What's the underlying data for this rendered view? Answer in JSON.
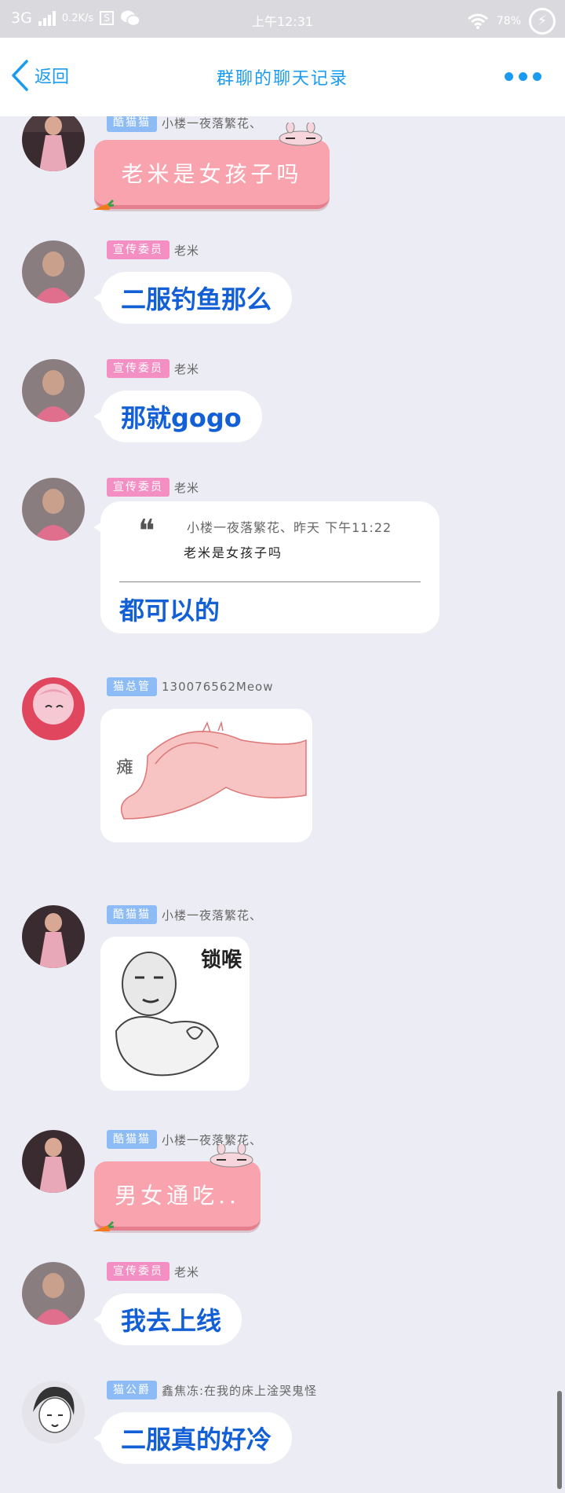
{
  "status_bar": {
    "network": "3G",
    "speed": "0.2K/s",
    "time": "上午12:31",
    "battery": "78%"
  },
  "nav": {
    "back_label": "返回",
    "title": "群聊的聊天记录"
  },
  "messages": [
    {
      "role_badge": "酷猫猫",
      "nickname": "小楼一夜落繁花、",
      "text": "老米是女孩子吗"
    },
    {
      "role_badge": "宣传委员",
      "nickname": "老米",
      "text": "二服钓鱼那么"
    },
    {
      "role_badge": "宣传委员",
      "nickname": "老米",
      "text": "那就gogo"
    },
    {
      "role_badge": "宣传委员",
      "nickname": "老米",
      "quote_meta": "小楼一夜落繁花、昨天 下午11:22",
      "quote_text": "老米是女孩子吗",
      "text": "都可以的"
    },
    {
      "role_badge": "猫总管",
      "nickname": "130076562Meow",
      "sticker_text": "瘫"
    },
    {
      "role_badge": "酷猫猫",
      "nickname": "小楼一夜落繁花、",
      "sticker_text": "锁喉"
    },
    {
      "role_badge": "酷猫猫",
      "nickname": "小楼一夜落繁花、",
      "text": "男女通吃.."
    },
    {
      "role_badge": "宣传委员",
      "nickname": "老米",
      "text": "我去上线"
    },
    {
      "role_badge": "猫公爵",
      "nickname": "鑫焦冻:在我的床上淦哭鬼怪",
      "text": "二服真的好冷"
    }
  ],
  "colors": {
    "accent": "#1a9bf0",
    "message_text": "#1360d6",
    "badge_blue": "#8dbbf5",
    "badge_pink": "#f48fc4",
    "pink_bubble": "#f8a3ad",
    "background": "#ececf4"
  },
  "icons": [
    "signal-icon",
    "sim-icon",
    "wechat-icon",
    "wifi-icon",
    "charging-icon",
    "back-chevron-icon",
    "more-icon",
    "carrot-icon",
    "bunny-icon",
    "quote-icon"
  ]
}
